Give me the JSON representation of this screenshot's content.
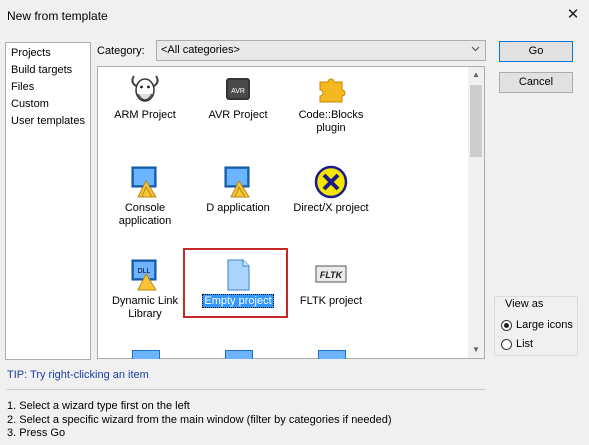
{
  "window": {
    "title": "New from template",
    "close_glyph": "✕"
  },
  "sidebar": {
    "items": [
      {
        "label": "Projects"
      },
      {
        "label": "Build targets"
      },
      {
        "label": "Files"
      },
      {
        "label": "Custom"
      },
      {
        "label": "User templates"
      }
    ]
  },
  "category": {
    "label": "Category:",
    "value": "<All categories>"
  },
  "templates": [
    {
      "label": "ARM Project",
      "icon": "gnu-icon"
    },
    {
      "label": "AVR Project",
      "icon": "avr-chip-icon"
    },
    {
      "label": "Code::Blocks plugin",
      "icon": "puzzle-piece-icon"
    },
    {
      "label": "Console application",
      "icon": "console-app-icon"
    },
    {
      "label": "D application",
      "icon": "d-app-icon"
    },
    {
      "label": "Direct/X project",
      "icon": "directx-icon"
    },
    {
      "label": "Dynamic Link Library",
      "icon": "dll-icon"
    },
    {
      "label": "Empty project",
      "icon": "empty-file-icon",
      "selected": true
    },
    {
      "label": "FLTK project",
      "icon": "fltk-icon"
    }
  ],
  "buttons": {
    "go": "Go",
    "cancel": "Cancel"
  },
  "view_as": {
    "title": "View as",
    "large_icons": "Large icons",
    "list": "List",
    "selected": "large_icons"
  },
  "tip": "TIP: Try right-clicking an item",
  "instructions": [
    "1. Select a wizard type first on the left",
    "2. Select a specific wizard from the main window (filter by categories if needed)",
    "3. Press Go"
  ],
  "colors": {
    "accent": "#0078d7",
    "selection": "#3399ff",
    "highlight_box": "#c62828",
    "tip": "#1a3fa0"
  }
}
